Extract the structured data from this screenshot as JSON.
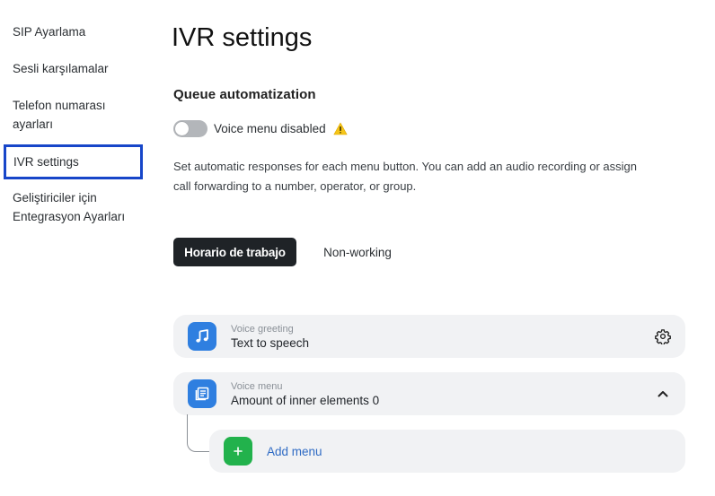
{
  "sidebar": {
    "items": [
      {
        "label": "SIP Ayarlama"
      },
      {
        "label": "Sesli karşılamalar"
      },
      {
        "label_line1": "Telefon numarası",
        "label_line2": "ayarları"
      },
      {
        "label": "IVR settings",
        "active": true
      },
      {
        "label_line1": "Geliştiriciler için",
        "label_line2": "Entegrasyon Ayarları"
      }
    ]
  },
  "main": {
    "title": "IVR settings",
    "section_title": "Queue automatization",
    "toggle": {
      "label": "Voice menu disabled",
      "on": false,
      "warning_icon": "warning-triangle-icon"
    },
    "description_line1": "Set automatic responses for each menu button. You can add an audio recording or assign",
    "description_line2": "call forwarding to a number, operator, or group.",
    "tabs": [
      {
        "label": "Horario de trabajo",
        "active": true
      },
      {
        "label": "Non-working",
        "active": false
      }
    ],
    "cards": {
      "greeting": {
        "sub": "Voice greeting",
        "main": "Text to speech",
        "icon": "music-note-icon",
        "action_icon": "gear-icon"
      },
      "voice_menu": {
        "sub": "Voice menu",
        "main": "Amount of inner elements 0",
        "icon": "list-document-icon",
        "action_icon": "chevron-up-icon"
      },
      "add_menu": {
        "label": "Add menu",
        "icon": "plus-icon"
      }
    }
  },
  "colors": {
    "accent_blue": "#2f7fe0",
    "add_green": "#22b24c",
    "active_tab_bg": "#1f2327",
    "sidebar_highlight": "#1746c9",
    "warning": "#f5c518"
  }
}
